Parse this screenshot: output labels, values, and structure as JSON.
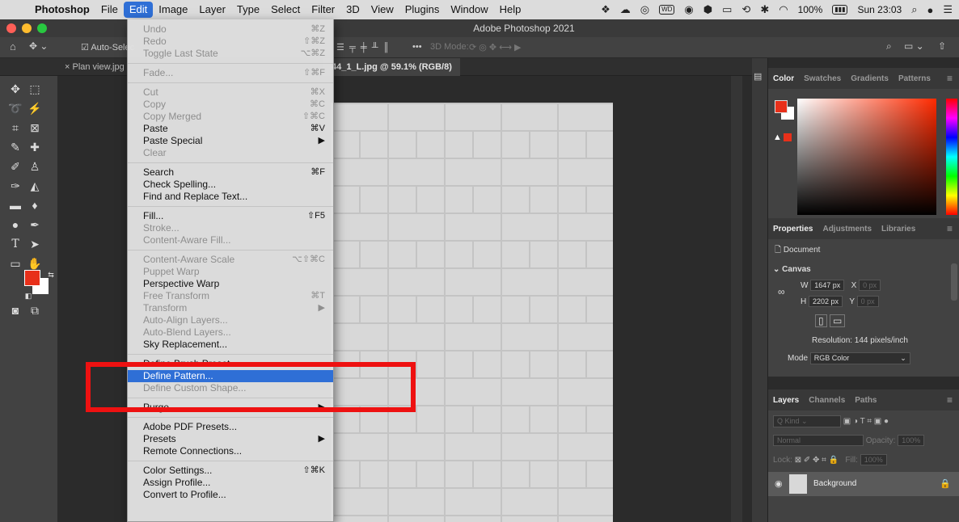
{
  "menubar": {
    "app": "Photoshop",
    "items": [
      "File",
      "Edit",
      "Image",
      "Layer",
      "Type",
      "Select",
      "Filter",
      "3D",
      "View",
      "Plugins",
      "Window",
      "Help"
    ],
    "active": "Edit",
    "battery": "100%",
    "clock": "Sun 23:03"
  },
  "window": {
    "title": "Adobe Photoshop 2021"
  },
  "options": {
    "auto_select": "Auto-Selec",
    "mode_3d": "3D Mode:"
  },
  "tabs": {
    "prev": "Plan view.jpg",
    "active": "44_1_L.jpg @ 59.1% (RGB/8)"
  },
  "edit_menu": [
    {
      "label": "Undo",
      "shortcut": "⌘Z",
      "disabled": true
    },
    {
      "label": "Redo",
      "shortcut": "⇧⌘Z",
      "disabled": true
    },
    {
      "label": "Toggle Last State",
      "shortcut": "⌥⌘Z",
      "disabled": true
    },
    {
      "sep": true
    },
    {
      "label": "Fade...",
      "shortcut": "⇧⌘F",
      "disabled": true
    },
    {
      "sep": true
    },
    {
      "label": "Cut",
      "shortcut": "⌘X",
      "disabled": true
    },
    {
      "label": "Copy",
      "shortcut": "⌘C",
      "disabled": true
    },
    {
      "label": "Copy Merged",
      "shortcut": "⇧⌘C",
      "disabled": true
    },
    {
      "label": "Paste",
      "shortcut": "⌘V",
      "disabled": false
    },
    {
      "label": "Paste Special",
      "shortcut": "▶",
      "disabled": false
    },
    {
      "label": "Clear",
      "shortcut": "",
      "disabled": true
    },
    {
      "sep": true
    },
    {
      "label": "Search",
      "shortcut": "⌘F",
      "disabled": false
    },
    {
      "label": "Check Spelling...",
      "shortcut": "",
      "disabled": false
    },
    {
      "label": "Find and Replace Text...",
      "shortcut": "",
      "disabled": false
    },
    {
      "sep": true
    },
    {
      "label": "Fill...",
      "shortcut": "⇧F5",
      "disabled": false
    },
    {
      "label": "Stroke...",
      "shortcut": "",
      "disabled": true
    },
    {
      "label": "Content-Aware Fill...",
      "shortcut": "",
      "disabled": true
    },
    {
      "sep": true
    },
    {
      "label": "Content-Aware Scale",
      "shortcut": "⌥⇧⌘C",
      "disabled": true
    },
    {
      "label": "Puppet Warp",
      "shortcut": "",
      "disabled": true
    },
    {
      "label": "Perspective Warp",
      "shortcut": "",
      "disabled": false
    },
    {
      "label": "Free Transform",
      "shortcut": "⌘T",
      "disabled": true
    },
    {
      "label": "Transform",
      "shortcut": "▶",
      "disabled": true
    },
    {
      "label": "Auto-Align Layers...",
      "shortcut": "",
      "disabled": true
    },
    {
      "label": "Auto-Blend Layers...",
      "shortcut": "",
      "disabled": true
    },
    {
      "label": "Sky Replacement...",
      "shortcut": "",
      "disabled": false
    },
    {
      "sep": true
    },
    {
      "label": "Define Brush Preset...",
      "shortcut": "",
      "disabled": false
    },
    {
      "label": "Define Pattern...",
      "shortcut": "",
      "disabled": false,
      "highlight": true
    },
    {
      "label": "Define Custom Shape...",
      "shortcut": "",
      "disabled": true
    },
    {
      "sep": true
    },
    {
      "label": "Purge",
      "shortcut": "▶",
      "disabled": false
    },
    {
      "sep": true
    },
    {
      "label": "Adobe PDF Presets...",
      "shortcut": "",
      "disabled": false
    },
    {
      "label": "Presets",
      "shortcut": "▶",
      "disabled": false
    },
    {
      "label": "Remote Connections...",
      "shortcut": "",
      "disabled": false
    },
    {
      "sep": true
    },
    {
      "label": "Color Settings...",
      "shortcut": "⇧⌘K",
      "disabled": false
    },
    {
      "label": "Assign Profile...",
      "shortcut": "",
      "disabled": false
    },
    {
      "label": "Convert to Profile...",
      "shortcut": "",
      "disabled": false
    }
  ],
  "color_panel": {
    "tabs": [
      "Color",
      "Swatches",
      "Gradients",
      "Patterns"
    ]
  },
  "properties_panel": {
    "tabs": [
      "Properties",
      "Adjustments",
      "Libraries"
    ],
    "document": "Document",
    "canvas": "Canvas",
    "w_label": "W",
    "w": "1647 px",
    "h_label": "H",
    "h": "2202 px",
    "x_label": "X",
    "x": "0 px",
    "y_label": "Y",
    "y": "0 px",
    "resolution": "Resolution: 144 pixels/inch",
    "mode_label": "Mode",
    "mode": "RGB Color"
  },
  "layers_panel": {
    "tabs": [
      "Layers",
      "Channels",
      "Paths"
    ],
    "kind": "Q Kind",
    "blend": "Normal",
    "opacity_label": "Opacity:",
    "opacity": "100%",
    "lock_label": "Lock:",
    "fill_label": "Fill:",
    "fill": "100%",
    "layer_name": "Background"
  },
  "colors": {
    "foreground": "#e8301a",
    "menu_highlight": "#2f6fd6",
    "annotation": "#ee1111"
  }
}
